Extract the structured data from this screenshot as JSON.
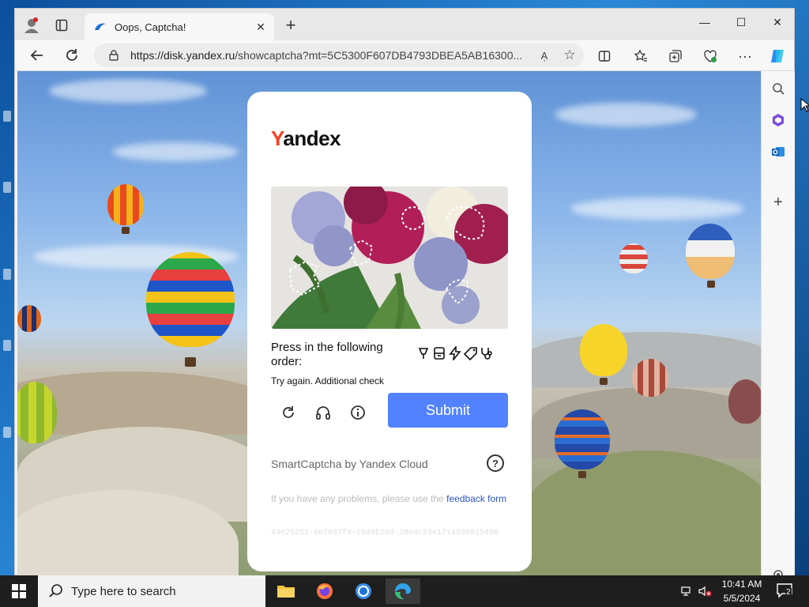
{
  "browser": {
    "tab_title": "Oops, Captcha!",
    "url_host": "https://disk.yandex.ru",
    "url_path": "/showcaptcha?mt=5C5300F607DB4793DBEA5AB16300...",
    "read_aloud_label": "Aͅ",
    "win_minimize": "—",
    "win_maximize": "☐",
    "win_close": "✕",
    "tab_close": "✕",
    "new_tab": "+"
  },
  "captcha": {
    "logo_first": "Y",
    "logo_rest": "andex",
    "instruction": "Press in the following order:",
    "error": "Try again. Additional check",
    "submit_label": "Submit",
    "brand": "SmartCaptcha by Yandex Cloud",
    "help_symbol": "?",
    "feedback_prefix": "If you have any problems, please use the ",
    "feedback_link": "feedback form",
    "request_id": "44e25251-6e7037f9-cb49b26d-28e4c53e1714930815490",
    "sequence_icons": [
      "lamp-icon",
      "archive-icon",
      "lightning-icon",
      "tag-icon",
      "stethoscope-icon"
    ]
  },
  "taskbar": {
    "search_placeholder": "Type here to search",
    "time": "10:41 AM",
    "date": "5/5/2024",
    "notification_count": "2"
  },
  "colors": {
    "accent": "#5282ff",
    "yandex_red": "#fc3f1d",
    "link": "#2b55c8"
  }
}
